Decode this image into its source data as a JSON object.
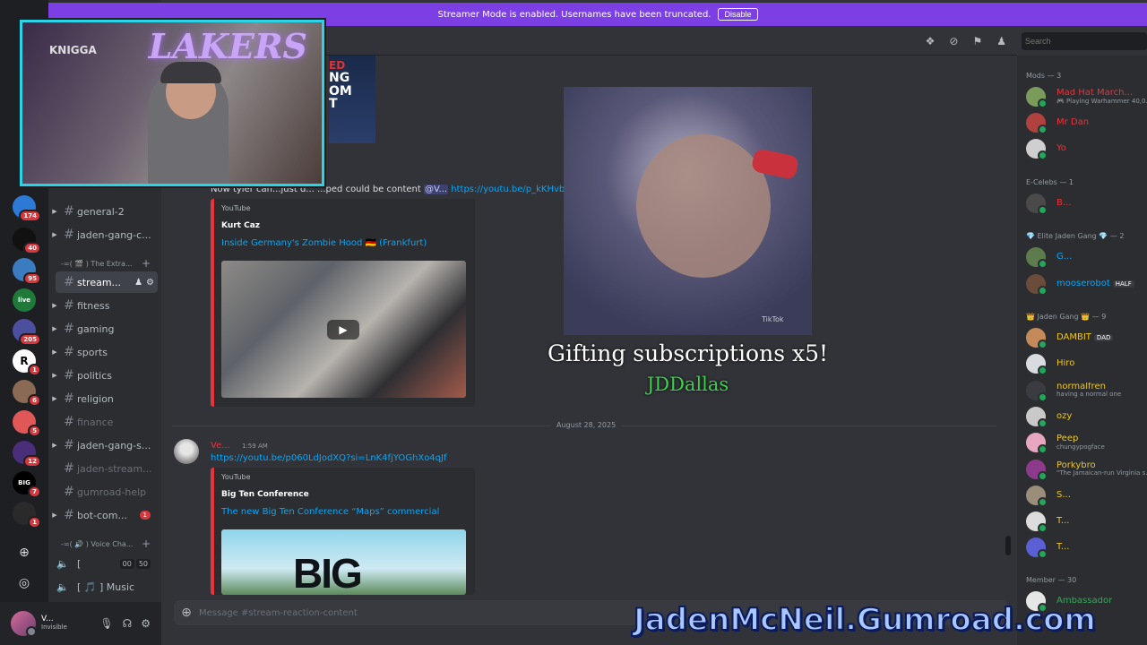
{
  "banner": {
    "text": "Streamer Mode is enabled. Usernames have been truncated.",
    "button": "Disable"
  },
  "search": {
    "placeholder": "Search"
  },
  "servers": [
    {
      "badge": "174",
      "color": "#2d7ad6"
    },
    {
      "badge": "40",
      "color": "#111111"
    },
    {
      "badge": "95",
      "color": "#3b7bbf"
    },
    {
      "badge": "",
      "color": "#1f7a3a",
      "label": "live"
    },
    {
      "badge": "205",
      "color": "#4b4f9e"
    },
    {
      "badge": "1",
      "color": "#ffffff",
      "label": "R"
    },
    {
      "badge": "6",
      "color": "#8a6a55"
    },
    {
      "badge": "5",
      "color": "#e05757"
    },
    {
      "badge": "12",
      "color": "#4a2e7a"
    },
    {
      "badge": "7",
      "color": "#000000",
      "label": "BIG"
    },
    {
      "badge": "1",
      "color": "#2a2a2a"
    }
  ],
  "channels": {
    "items_top": [
      {
        "label": "general-2",
        "arrow": true
      },
      {
        "label": "jaden-gang-c...",
        "arrow": true
      }
    ],
    "category1": "-=( 🎬 ) The Extra...",
    "items_mid": [
      {
        "label": "stream...",
        "active": true
      },
      {
        "label": "fitness",
        "arrow": true
      },
      {
        "label": "gaming",
        "arrow": true
      },
      {
        "label": "sports",
        "arrow": true
      },
      {
        "label": "politics",
        "arrow": true
      },
      {
        "label": "religion",
        "arrow": true
      },
      {
        "label": "finance",
        "muted": true
      },
      {
        "label": "jaden-gang-s...",
        "arrow": true
      },
      {
        "label": "jaden-stream...",
        "muted": true
      },
      {
        "label": "gumroad-help",
        "muted": true
      },
      {
        "label": "bot-com...",
        "arrow": true,
        "badge": "1"
      }
    ],
    "category2": "-=( 🔊 ) Voice Cha...",
    "voice": [
      {
        "label": "[",
        "counts": [
          "00",
          "50"
        ]
      },
      {
        "label": "[ 🎵 ] Music"
      }
    ]
  },
  "user": {
    "name": "V...",
    "status": "Invisible"
  },
  "messages": {
    "msg1": {
      "text": "Now tyler can...just d... ...ped could be content",
      "mention": "@V...",
      "link": "https://youtu.be/p_kKHvbZ4IE"
    },
    "embed1": {
      "provider": "YouTube",
      "author": "Kurt Caz",
      "title": "Inside Germany's Zombie Hood 🇩🇪 (Frankfurt)"
    },
    "date_divider": "August 28, 2025",
    "msg2": {
      "author": "Ve...",
      "time": "1:59 AM",
      "link": "https://youtu.be/p060LdJodXQ?si=LnK4fjYOGhXo4qJf"
    },
    "embed2": {
      "provider": "YouTube",
      "author": "Big Ten Conference",
      "title": "The new Big Ten Conference “Maps” commercial"
    }
  },
  "composer": {
    "placeholder": "Message #stream-reaction-content"
  },
  "members": {
    "groups": [
      {
        "title": "Mods — 3",
        "items": [
          {
            "name": "Mad Hat March...",
            "sub": "🎮 Playing Warhammer 40,0...",
            "color": "#e8333a",
            "av": "#7a9b5a"
          },
          {
            "name": "Mr Dan",
            "sub": "",
            "color": "#e8333a",
            "av": "#b0413e"
          },
          {
            "name": "Yo",
            "sub": "",
            "color": "#e8333a",
            "av": "#cfcfcf"
          }
        ]
      },
      {
        "title": "E-Celebs — 1",
        "items": [
          {
            "name": "B...",
            "sub": "",
            "color": "#e8333a",
            "av": "#4a4a4a"
          }
        ]
      },
      {
        "title": "💎 Elite Jaden Gang 💎 — 2",
        "items": [
          {
            "name": "G...",
            "sub": "",
            "color": "#00a8fc",
            "av": "#5d7b4d"
          },
          {
            "name": "mooserobot",
            "sub": "",
            "tag": "HALF",
            "color": "#00a8fc",
            "av": "#6b4b3a"
          }
        ]
      },
      {
        "title": "👑 Jaden Gang 👑 — 9",
        "items": [
          {
            "name": "DAMBIT",
            "sub": "",
            "tag": "DAD",
            "color": "#f0c61a",
            "av": "#c48a5a"
          },
          {
            "name": "Hiro",
            "sub": "",
            "color": "#f0c61a",
            "av": "#d8dbe0"
          },
          {
            "name": "normalfren",
            "sub": "having a normal one",
            "color": "#f0c61a",
            "av": "#3a3c42"
          },
          {
            "name": "ozy",
            "sub": "",
            "color": "#f0c61a",
            "av": "#c9c9c9"
          },
          {
            "name": "Peep",
            "sub": "chungypogface",
            "color": "#f0c61a",
            "av": "#e7a7c0"
          },
          {
            "name": "Porkybro",
            "sub": "\"The Jamaican-run Virginia s...",
            "color": "#f0c61a",
            "av": "#8e3a8c"
          },
          {
            "name": "S...",
            "sub": "",
            "color": "#f0c61a",
            "av": "#9a8d7a"
          },
          {
            "name": "T...",
            "sub": "",
            "color": "#f0c61a",
            "av": "#dcdcdc"
          },
          {
            "name": "T...",
            "sub": "",
            "color": "#f0c61a",
            "av": "#5a5fd4"
          }
        ]
      },
      {
        "title": "Member — 30",
        "items": [
          {
            "name": "Ambassador",
            "sub": "",
            "color": "#3ba55c",
            "av": "#e6e6e6"
          }
        ]
      }
    ]
  },
  "webcam": {
    "jersey": "KNIGGA",
    "brand": "LAKERS"
  },
  "overlay": {
    "gift_title": "Gifting subscriptions x5!",
    "gift_user": "JDDallas",
    "watermark": "TikTok"
  },
  "promo": {
    "text": "JadenMcNeil.Gumroad.com"
  },
  "colors": {
    "banner": "#7b3fe4",
    "accent_link": "#00a8fc",
    "embed_border": "#e8333a",
    "webcam_border": "#29d4e6"
  }
}
